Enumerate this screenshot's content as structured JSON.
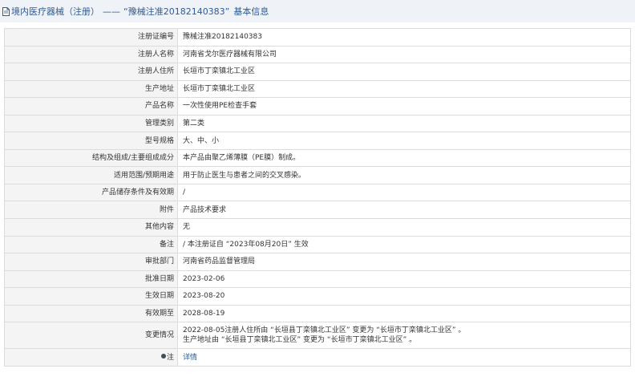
{
  "breadcrumb": {
    "main": "境内医疗器械（注册）",
    "separator": "——",
    "reg_no": "“豫械注准20182140383”",
    "title": "基本信息"
  },
  "rows": [
    {
      "label": "注册证编号",
      "value": "豫械注准20182140383"
    },
    {
      "label": "注册人名称",
      "value": "河南省戈尔医疗器械有限公司"
    },
    {
      "label": "注册人住所",
      "value": "长垣市丁栾镇北工业区"
    },
    {
      "label": "生产地址",
      "value": "长垣市丁栾镇北工业区"
    },
    {
      "label": "产品名称",
      "value": "一次性使用PE检查手套"
    },
    {
      "label": "管理类别",
      "value": "第二类"
    },
    {
      "label": "型号规格",
      "value": "大、中、小"
    },
    {
      "label": "结构及组成/主要组成成分",
      "value": "本产品由聚乙烯薄膜（PE膜）制成。"
    },
    {
      "label": "适用范围/预期用途",
      "value": "用于防止医生与患者之间的交叉感染。"
    },
    {
      "label": "产品储存条件及有效期",
      "value": "/"
    },
    {
      "label": "附件",
      "value": "产品技术要求"
    },
    {
      "label": "其他内容",
      "value": "无"
    },
    {
      "label": "备注",
      "value": "/ 本注册证自 “2023年08月20日” 生效"
    },
    {
      "label": "审批部门",
      "value": "河南省药品监督管理局"
    },
    {
      "label": "批准日期",
      "value": "2023-02-06"
    },
    {
      "label": "生效日期",
      "value": "2023-08-20"
    },
    {
      "label": "有效期至",
      "value": "2028-08-19"
    }
  ],
  "change": {
    "label": "变更情况",
    "line1": "2022-08-05注册人住所由 “长垣县丁栾镇北工业区” 变更为 “长垣市丁栾镇北工业区” 。",
    "line2": "生产地址由 “长垣县丁栾镇北工业区” 变更为 “长垣市丁栾镇北工业区” 。"
  },
  "note": {
    "label": "注",
    "link": "详情"
  },
  "colors": {
    "accent": "#2f5b94",
    "header_bg": "#eff2f6",
    "label_bg": "#f4f4f4",
    "border": "#dcdcdc"
  }
}
